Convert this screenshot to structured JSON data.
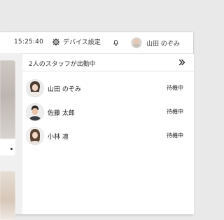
{
  "header": {
    "time": "15:25:40",
    "settings_label": "デバイス設定",
    "user_name": "山田 のぞみ"
  },
  "staff_panel": {
    "title": "2人のスタッフが出勤中",
    "staff": [
      {
        "name": "山田 のぞみ",
        "status": "待機中"
      },
      {
        "name": "佐藤 太郎",
        "status": "待機中"
      },
      {
        "name": "小林 凛",
        "status": "待機中"
      }
    ]
  },
  "icons": {
    "settings": "gear-icon",
    "notifications": "bell-icon",
    "collapse": "double-chevron-right-icon"
  }
}
